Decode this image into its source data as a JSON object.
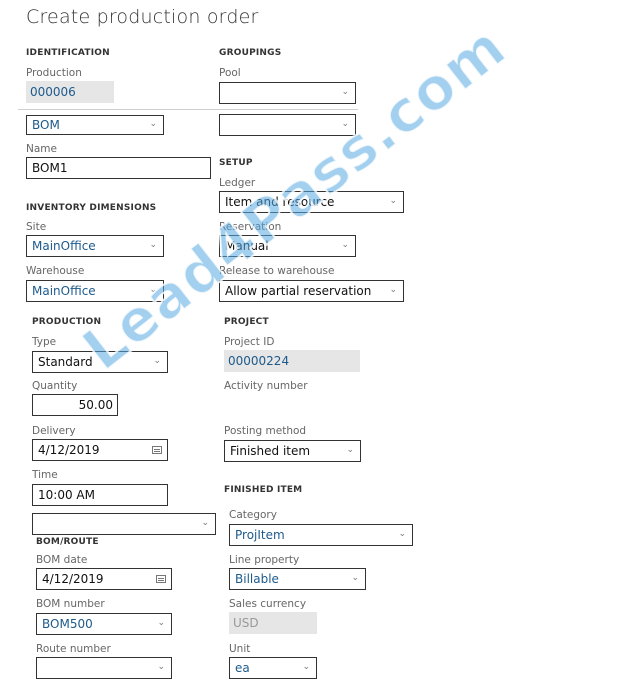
{
  "page": {
    "title": "Create production order"
  },
  "identification": {
    "section": "IDENTIFICATION",
    "production_label": "Production",
    "production_value": "000006",
    "type_select_value": "BOM",
    "name_label": "Name",
    "name_value": "BOM1"
  },
  "groupings": {
    "section": "GROUPINGS",
    "pool_label": "Pool",
    "pool_value": "",
    "second_value": ""
  },
  "setup": {
    "section": "SETUP",
    "ledger_label": "Ledger",
    "ledger_value": "Item and resource",
    "reservation_label": "Reservation",
    "reservation_value": "Manual",
    "release_label": "Release to warehouse",
    "release_value": "Allow partial reservation"
  },
  "inventory_dimensions": {
    "section": "INVENTORY DIMENSIONS",
    "site_label": "Site",
    "site_value": "MainOffice",
    "warehouse_label": "Warehouse",
    "warehouse_value": "MainOffice"
  },
  "production": {
    "section": "PRODUCTION",
    "type_label": "Type",
    "type_value": "Standard",
    "quantity_label": "Quantity",
    "quantity_value": "50.00",
    "delivery_label": "Delivery",
    "delivery_value": "4/12/2019",
    "time_label": "Time",
    "time_value": "10:00 AM",
    "extra_value": ""
  },
  "project": {
    "section": "PROJECT",
    "project_id_label": "Project ID",
    "project_id_value": "00000224",
    "activity_label": "Activity number",
    "posting_label": "Posting method",
    "posting_value": "Finished item"
  },
  "finished_item": {
    "section": "FINISHED ITEM",
    "category_label": "Category",
    "category_value": "ProjItem",
    "line_property_label": "Line property",
    "line_property_value": "Billable",
    "currency_label": "Sales currency",
    "currency_value": "USD",
    "unit_label": "Unit",
    "unit_value": "ea"
  },
  "bom_route": {
    "section": "BOM/ROUTE",
    "bom_date_label": "BOM date",
    "bom_date_value": "4/12/2019",
    "bom_number_label": "BOM number",
    "bom_number_value": "BOM500",
    "route_label": "Route number",
    "route_value": ""
  },
  "icons": {
    "dropdown": "⌄",
    "watermark": "Lead4Pass.com"
  }
}
